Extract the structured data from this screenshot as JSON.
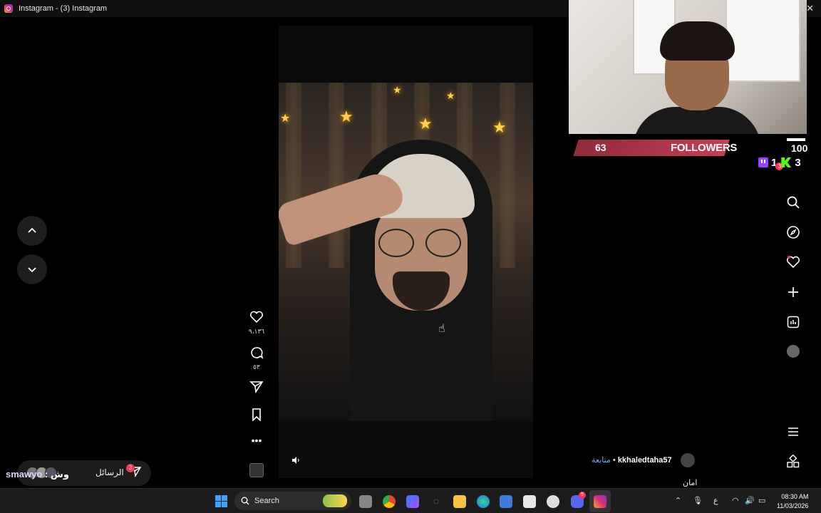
{
  "window": {
    "title": "Instagram - (3) Instagram"
  },
  "reel": {
    "likes": "٩،١٣٦",
    "comments": "٥٣"
  },
  "stream_overlay": {
    "followers_count": "63",
    "followers_label": "FOLLOWERS",
    "followers_goal": "100",
    "twitch_count": "1",
    "kick_count": "3",
    "notification_badge": "3"
  },
  "messages": {
    "label": "الرسائل",
    "badge": "3"
  },
  "chat": {
    "username": "smawyo",
    "separator": " : ",
    "message": "وش"
  },
  "author": {
    "username": "kkhaledtaha57",
    "separator": " • ",
    "follow_label": "متابعة",
    "caption": "امان"
  },
  "taskbar": {
    "search_label": "Search",
    "discord_badge": "5",
    "lang": "ع",
    "time": "08:30 AM",
    "date": "11/03/2026"
  },
  "colors": {
    "accent_follow": "#7fa9ff",
    "badge_red": "#ff2f55",
    "followers_bar": "#c63e55",
    "twitch": "#9146ff",
    "kick": "#53fc18"
  }
}
